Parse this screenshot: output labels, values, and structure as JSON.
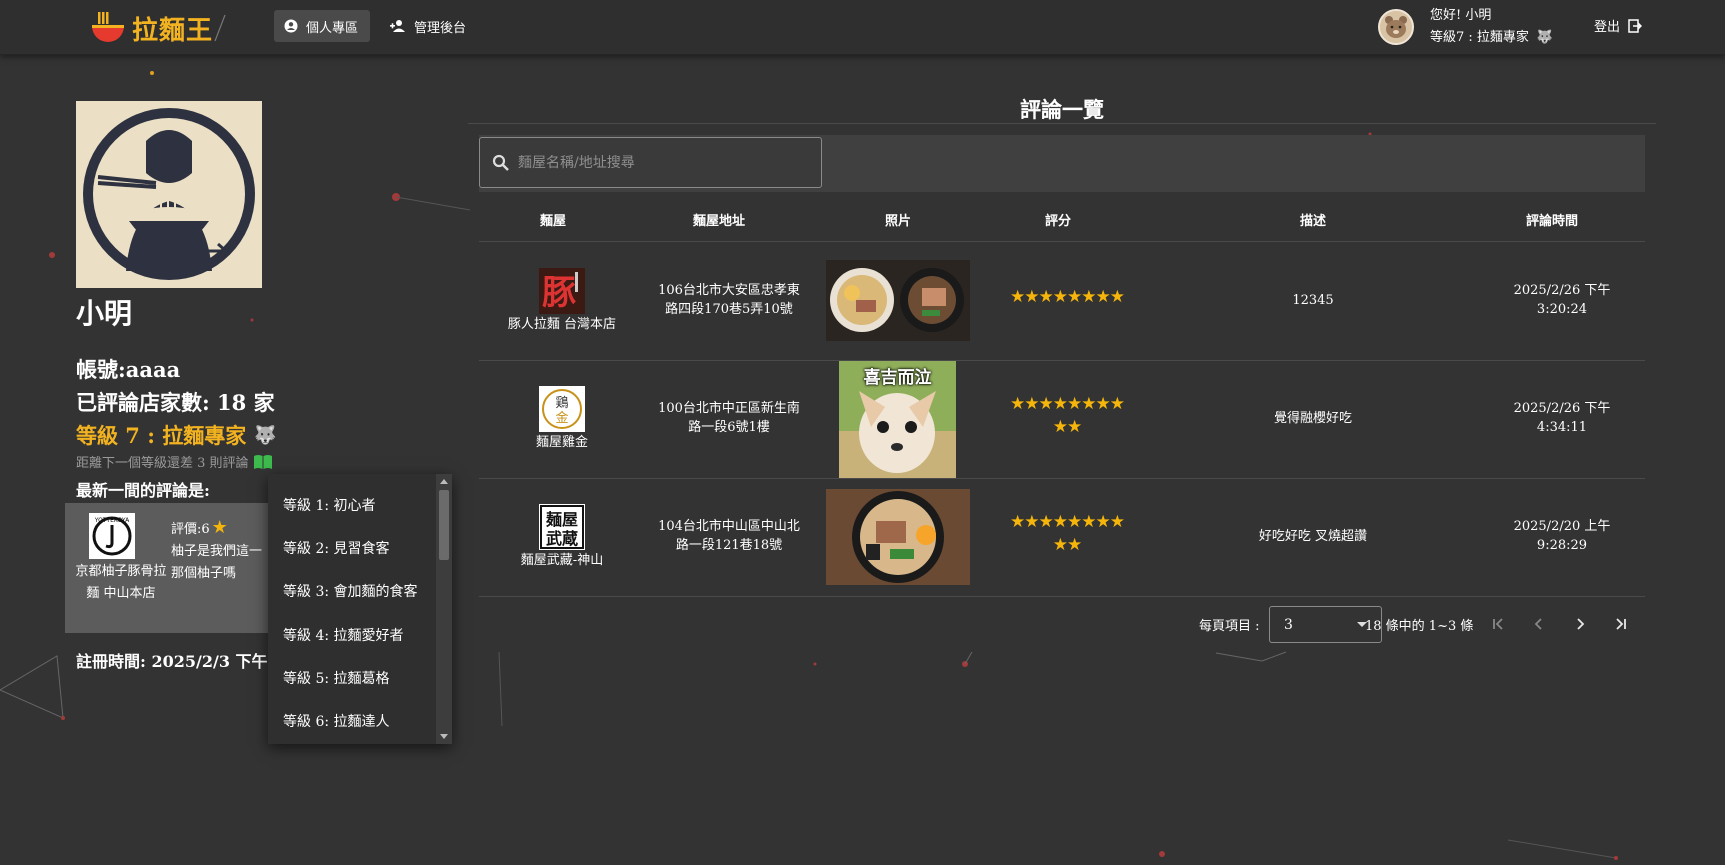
{
  "navbar": {
    "logo_text": "拉麵王",
    "tab_profile": "個人專區",
    "tab_admin": "管理後台",
    "greeting": "您好! 小明",
    "user_level": "等級7 : 拉麵專家",
    "logout_label": "登出"
  },
  "profile": {
    "name": "小明",
    "account": "帳號:aaaa",
    "review_count": "已評論店家數: 18 家",
    "level": "等級 7 : 拉麵專家",
    "next_level_hint": "距離下一個等級還差 3 則評論",
    "latest_label": "最新一間的評論是:",
    "latest_shop": "京都柚子豚骨拉麵 中山本店",
    "latest_rating": "評價:6",
    "latest_desc_1": "柚子是我們這一",
    "latest_desc_2": "那個柚子嗎",
    "register_time": "註冊時間: 2025/2/3 下午"
  },
  "level_dropdown": [
    "等級 1: 初心者",
    "等級 2: 見習食客",
    "等級 3: 會加麵的食客",
    "等級 4: 拉麵愛好者",
    "等級 5: 拉麵葛格",
    "等級 6: 拉麵達人"
  ],
  "panel": {
    "title": "評論一覽",
    "search_placeholder": "麵屋名稱/地址搜尋"
  },
  "table": {
    "headers": [
      "麵屋",
      "麵屋地址",
      "照片",
      "評分",
      "描述",
      "評論時間"
    ],
    "rows": [
      {
        "shop": "豚人拉麵 台灣本店",
        "address_1": "106台北市大安區忠孝東",
        "address_2": "路四段170巷5弄10號",
        "rating": 8,
        "stars_line1": "★★★★★★★★",
        "stars_line2": "",
        "description": "12345",
        "time_1": "2025/2/26 下午",
        "time_2": "3:20:24"
      },
      {
        "shop": "麵屋雞金",
        "address_1": "100台北市中正區新生南",
        "address_2": "路一段6號1樓",
        "rating": 10,
        "stars_line1": "★★★★★★★★",
        "stars_line2": "★★",
        "photo_caption": "喜吉而泣",
        "description": "覺得融櫻好吃",
        "time_1": "2025/2/26 下午",
        "time_2": "4:34:11"
      },
      {
        "shop": "麵屋武藏-神山",
        "address_1": "104台北市中山區中山北",
        "address_2": "路一段121巷18號",
        "rating": 10,
        "stars_line1": "★★★★★★★★",
        "stars_line2": "★★",
        "description": "好吃好吃 叉燒超讚",
        "time_1": "2025/2/20 上午",
        "time_2": "9:28:29"
      }
    ]
  },
  "pagination": {
    "per_page_label": "每頁項目 :",
    "per_page_value": "3",
    "range_text": "18 條中的 1~3 條"
  },
  "colors": {
    "accent": "#f3b321",
    "star": "#f5b50a",
    "background": "#333333",
    "navbar": "#2f2f2f"
  }
}
